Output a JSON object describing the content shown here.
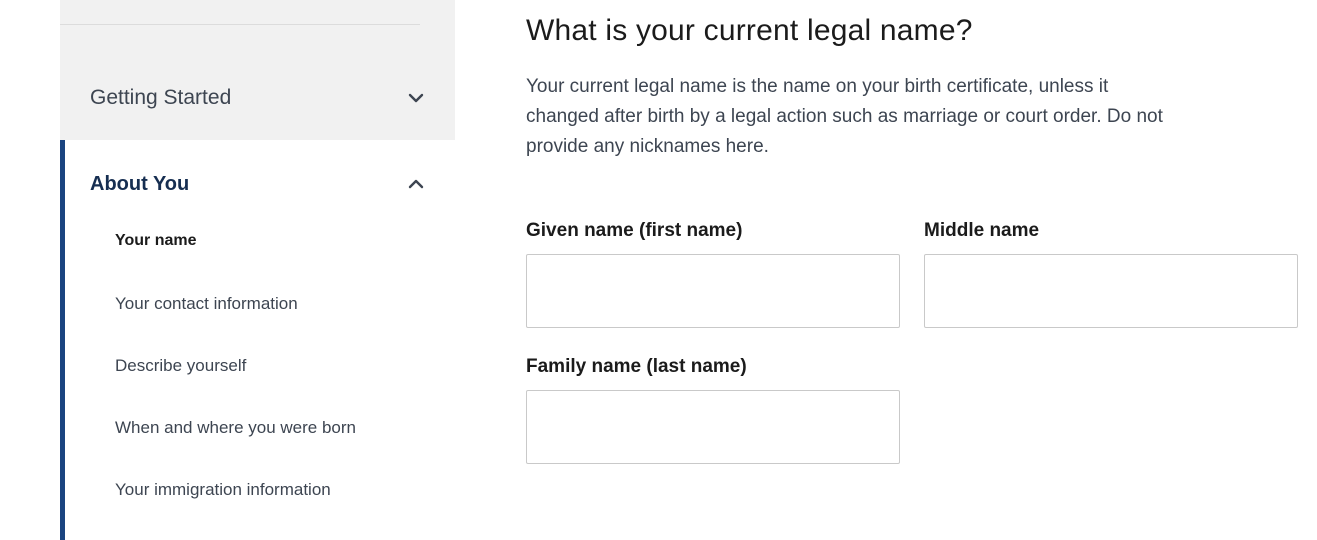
{
  "sidebar": {
    "sections": [
      {
        "label": "Getting Started",
        "icon": "chevron-down-icon",
        "expanded": false
      },
      {
        "label": "About You",
        "icon": "chevron-up-icon",
        "expanded": true
      }
    ],
    "about_you_items": [
      {
        "label": "Your name",
        "current": true
      },
      {
        "label": "Your contact information",
        "current": false
      },
      {
        "label": "Describe yourself",
        "current": false
      },
      {
        "label": "When and where you were born",
        "current": false
      },
      {
        "label": "Your immigration information",
        "current": false
      }
    ],
    "accent_color": "#1a4480"
  },
  "main": {
    "title": "What is your current legal name?",
    "intro_line1": "Your current legal name is the name on your birth certificate, unless it",
    "intro_line2": "changed after birth by a legal action such as marriage or court order. Do not",
    "intro_line3": "provide any nicknames here.",
    "fields": {
      "given_name": {
        "label": "Given name (first name)",
        "value": ""
      },
      "middle_name": {
        "label": "Middle name",
        "value": ""
      },
      "family_name": {
        "label": "Family name (last name)",
        "value": ""
      }
    }
  }
}
